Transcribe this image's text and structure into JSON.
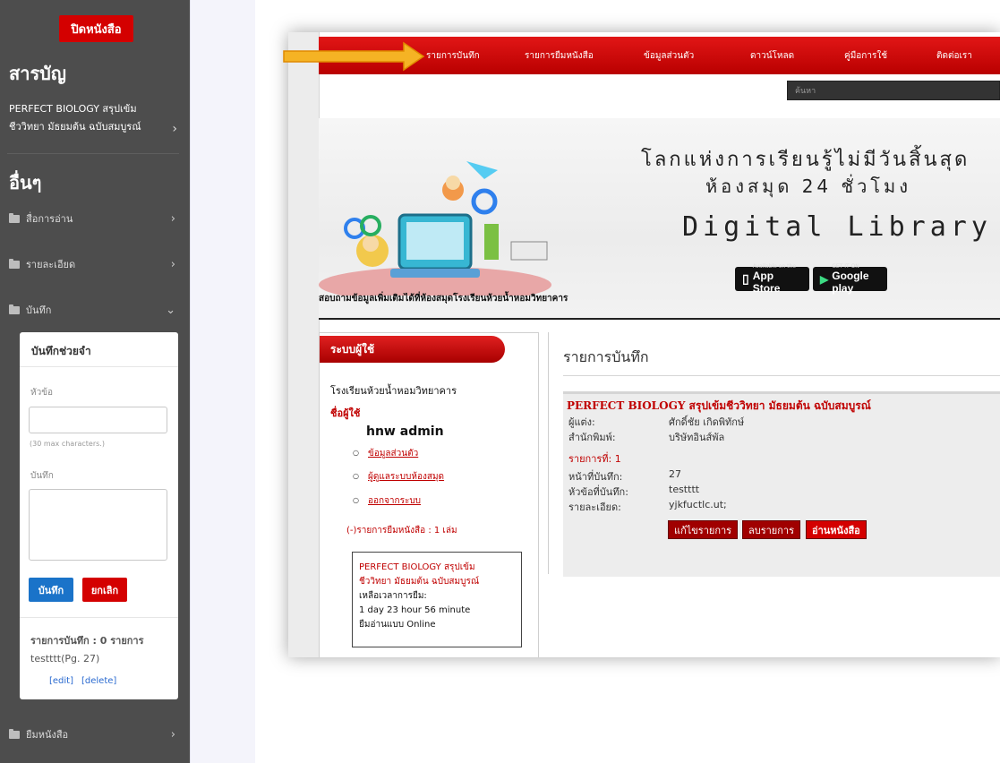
{
  "sidebar": {
    "close_book": "ปิดหนังสือ",
    "toc_heading": "สารบัญ",
    "book_title_line1": "PERFECT BIOLOGY สรุปเข้ม",
    "book_title_line2": "ชีววิทยา มัธยมต้น ฉบับสมบูรณ์",
    "other_heading": "อื่นๆ",
    "items": [
      {
        "label": "สื่อการอ่าน"
      },
      {
        "label": "รายละเอียด"
      },
      {
        "label": "บันทึก"
      },
      {
        "label": "ยืมหนังสือ"
      }
    ],
    "note_card": {
      "title": "บันทึกช่วยจำ",
      "topic_label": "หัวข้อ",
      "topic_value": "",
      "max_hint": "(30 max characters.)",
      "note_label": "บันทึก",
      "note_value": "",
      "save": "บันทึก",
      "cancel": "ยกเลิก",
      "count_text": "รายการบันทึก : 0 รายการ",
      "entry": "testttt(Pg. 27)",
      "edit": "[edit]",
      "delete": "[delete]"
    }
  },
  "site": {
    "nav": [
      "รายการบันทึก",
      "รายการยืมหนังสือ",
      "ข้อมูลส่วนตัว",
      "ดาวน์โหลด",
      "คู่มือการใช้",
      "ติดต่อเรา"
    ],
    "search_placeholder": "ค้นหา",
    "banner": {
      "line1": "โลกแห่งการเรียนรู้ไม่มีวันสิ้นสุด",
      "line2": "ห้องสมุด 24 ชั่วโมง",
      "line3": "Digital Library",
      "appstore_small": "Available on the",
      "appstore": "App Store",
      "googleplay_small": "GET IT ON",
      "googleplay": "Google play",
      "caption": "สอบถามข้อมูลเพิ่มเติมได้ที่ห้องสมุดโรงเรียนห้วยน้ำหอมวิทยาคาร"
    },
    "user_panel": {
      "title": "ระบบผู้ใช้",
      "school": "โรงเรียนห้วยน้ำหอมวิทยาคาร",
      "user_label": "ชื่อผู้ใช้",
      "username": "hnw admin",
      "links": [
        "ข้อมูลส่วนตัว",
        "ผู้ดูแลระบบห้องสมุด",
        "ออกจากระบบ"
      ],
      "borrow_text": "(-)รายการยืมหนังสือ : 1 เล่ม",
      "box_title_line1": "PERFECT BIOLOGY สรุปเข้ม",
      "box_title_line2": "ชีววิทยา มัธยมต้น ฉบับสมบูรณ์",
      "box_time_label": "เหลือเวลาการยืม:",
      "box_time": "1 day 23 hour 56 minute",
      "box_mode": "ยืมอ่านแบบ Online"
    },
    "content": {
      "title": "รายการบันทึก",
      "record": {
        "book_title": "PERFECT BIOLOGY สรุปเข้มชีววิทยา มัธยมต้น ฉบับสมบูรณ์",
        "author_label": "ผู้แต่ง:",
        "author": "ศักดิ์ชัย เกิดพิทักษ์",
        "publisher_label": "สำนักพิมพ์:",
        "publisher": "บริษัทอินส์พัล",
        "item_no": "รายการที่: 1",
        "page_label": "หน้าที่บันทึก:",
        "page": "27",
        "topic_label": "หัวข้อที่บันทึก:",
        "topic": "testttt",
        "detail_label": "รายละเอียด:",
        "detail": "yjkfuctlc.ut;",
        "btn_edit": "แก้ไขรายการ",
        "btn_delete": "ลบรายการ",
        "btn_read": "อ่านหนังสือ"
      }
    }
  },
  "colors": {
    "accent_red": "#d40000",
    "sidebar_bg": "#4d4d4d",
    "save_blue": "#1a73c9",
    "arrow_yellow": "#f5b324"
  }
}
